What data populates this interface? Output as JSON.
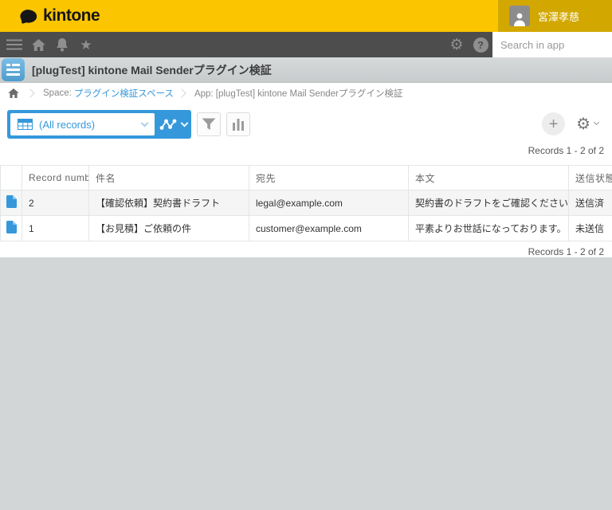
{
  "header": {
    "logo_text": "kintone",
    "user_name": "宮澤孝慈"
  },
  "nav": {
    "search_placeholder": "Search in app"
  },
  "app": {
    "title": "[plugTest] kintone Mail Senderプラグイン検証"
  },
  "breadcrumb": {
    "space_label": "Space:",
    "space_link": "プラグイン検証スペース",
    "app_crumb": "App: [plugTest] kintone Mail Senderプラグイン検証"
  },
  "toolbar": {
    "view_selector_label": "(All records)"
  },
  "records_info": {
    "top": "Records 1 - 2 of 2",
    "bottom": "Records 1 - 2 of 2"
  },
  "table": {
    "headers": [
      "Record number",
      "件名",
      "宛先",
      "本文",
      "送信状態"
    ],
    "rows": [
      {
        "record_number": "2",
        "subject": "【確認依頼】契約書ドラフト",
        "to": "legal@example.com",
        "body": "契約書のドラフトをご確認ください。",
        "status": "送信済"
      },
      {
        "record_number": "1",
        "subject": "【お見積】ご依頼の件",
        "to": "customer@example.com",
        "body": "平素よりお世話になっております。 標記の件...",
        "status": "未送信"
      }
    ]
  },
  "icons": {
    "star": "★",
    "gear": "⚙",
    "help": "?",
    "plus": "+"
  },
  "colors": {
    "brand_yellow": "#FBC500",
    "user_area_yellow": "#D2A800",
    "nav_gray": "#4D4D4D",
    "accent_blue": "#3598DB",
    "page_background": "#D2D6D7",
    "status_row_alt": "#F5F5F5"
  }
}
